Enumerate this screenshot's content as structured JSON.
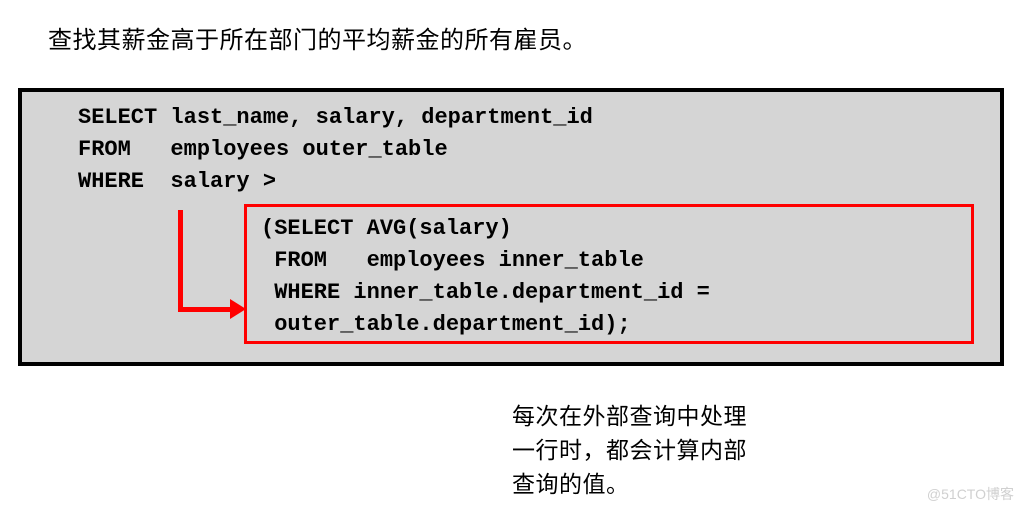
{
  "title": "查找其薪金高于所在部门的平均薪金的所有雇员。",
  "code": {
    "outer_line1": "SELECT last_name, salary, department_id",
    "outer_line2": "FROM   employees outer_table",
    "outer_line3": "WHERE  salary >",
    "inner_line1": "(SELECT AVG(salary)",
    "inner_line2": " FROM   employees inner_table",
    "inner_line3": " WHERE inner_table.department_id =",
    "inner_line4": " outer_table.department_id);"
  },
  "footer": {
    "line1": "每次在外部查询中处理",
    "line2": "一行时，都会计算内部",
    "line3": "查询的值。"
  },
  "watermark": "@51CTO博客"
}
